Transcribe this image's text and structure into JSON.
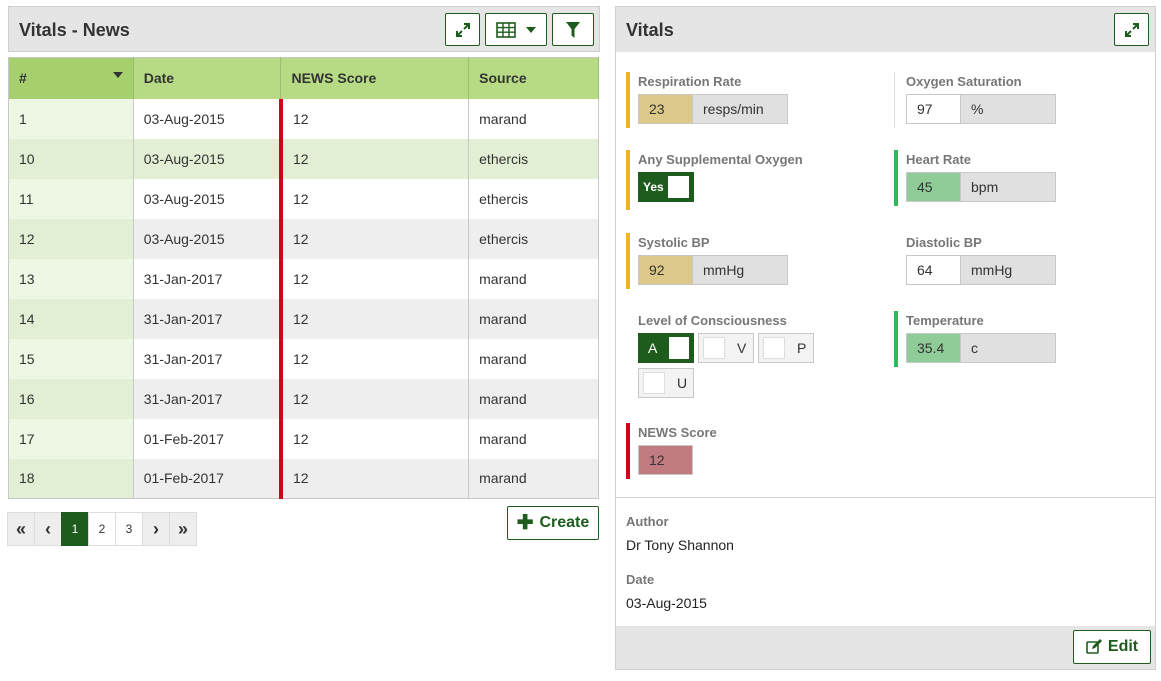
{
  "left": {
    "title": "Vitals - News",
    "columns": [
      "#",
      "Date",
      "NEWS Score",
      "Source"
    ],
    "rows": [
      {
        "num": "1",
        "date": "03-Aug-2015",
        "score": "12",
        "source": "marand"
      },
      {
        "num": "10",
        "date": "03-Aug-2015",
        "score": "12",
        "source": "ethercis"
      },
      {
        "num": "11",
        "date": "03-Aug-2015",
        "score": "12",
        "source": "ethercis"
      },
      {
        "num": "12",
        "date": "03-Aug-2015",
        "score": "12",
        "source": "ethercis"
      },
      {
        "num": "13",
        "date": "31-Jan-2017",
        "score": "12",
        "source": "marand"
      },
      {
        "num": "14",
        "date": "31-Jan-2017",
        "score": "12",
        "source": "marand"
      },
      {
        "num": "15",
        "date": "31-Jan-2017",
        "score": "12",
        "source": "marand"
      },
      {
        "num": "16",
        "date": "31-Jan-2017",
        "score": "12",
        "source": "marand"
      },
      {
        "num": "17",
        "date": "01-Feb-2017",
        "score": "12",
        "source": "marand"
      },
      {
        "num": "18",
        "date": "01-Feb-2017",
        "score": "12",
        "source": "marand"
      }
    ],
    "pagination": {
      "first": "«",
      "prev": "‹",
      "pages": [
        "1",
        "2",
        "3"
      ],
      "next": "›",
      "last": "»",
      "active_page": "1"
    },
    "create_label": "Create"
  },
  "right": {
    "title": "Vitals",
    "respiration": {
      "label": "Respiration Rate",
      "value": "23",
      "unit": "resps/min"
    },
    "oxygen_saturation": {
      "label": "Oxygen Saturation",
      "value": "97",
      "unit": "%"
    },
    "supplemental_oxygen": {
      "label": "Any Supplemental Oxygen",
      "value": "Yes"
    },
    "heart_rate": {
      "label": "Heart Rate",
      "value": "45",
      "unit": "bpm"
    },
    "systolic": {
      "label": "Systolic BP",
      "value": "92",
      "unit": "mmHg"
    },
    "diastolic": {
      "label": "Diastolic BP",
      "value": "64",
      "unit": "mmHg"
    },
    "consciousness": {
      "label": "Level of Consciousness",
      "options": [
        "A",
        "V",
        "P",
        "U"
      ],
      "selected": "A"
    },
    "temperature": {
      "label": "Temperature",
      "value": "35.4",
      "unit": "c"
    },
    "news_score": {
      "label": "NEWS Score",
      "value": "12"
    },
    "author_label": "Author",
    "author": "Dr Tony Shannon",
    "date_label": "Date",
    "date": "03-Aug-2015",
    "edit_label": "Edit"
  },
  "colors": {
    "primary_green": "#1e5c1e",
    "header_green": "#b7db85",
    "amber": "#f0b323",
    "green": "#2eb85c",
    "red": "#d0021b",
    "amber_fill": "#dcc98a",
    "green_fill": "#8fcc98",
    "red_fill": "#c27b80"
  },
  "icons": [
    "expand-icon",
    "table-icon",
    "caret-down-icon",
    "filter-icon",
    "plus-icon",
    "edit-icon"
  ]
}
